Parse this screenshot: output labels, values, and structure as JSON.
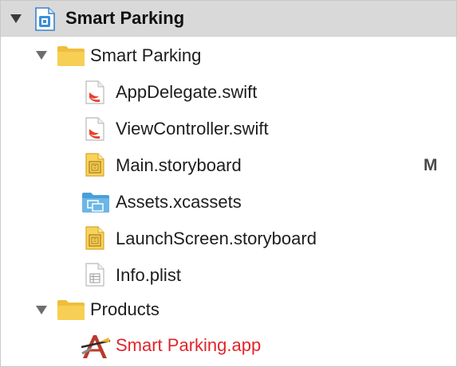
{
  "navigator": {
    "project": {
      "label": "Smart Parking",
      "icon": "xcode-project-icon"
    },
    "group": {
      "label": "Smart Parking",
      "icon": "folder-icon"
    },
    "files": [
      {
        "label": "AppDelegate.swift",
        "icon": "swift-file-icon"
      },
      {
        "label": "ViewController.swift",
        "icon": "swift-file-icon"
      },
      {
        "label": "Main.storyboard",
        "icon": "storyboard-file-icon",
        "badge": "M"
      },
      {
        "label": "Assets.xcassets",
        "icon": "asset-catalog-icon"
      },
      {
        "label": "LaunchScreen.storyboard",
        "icon": "storyboard-file-icon"
      },
      {
        "label": "Info.plist",
        "icon": "plist-file-icon"
      }
    ],
    "products_group": {
      "label": "Products",
      "icon": "folder-icon"
    },
    "product": {
      "label": "Smart Parking.app",
      "icon": "app-product-icon"
    }
  },
  "colors": {
    "selection": "#d9d9d9",
    "folder": "#f3c649",
    "swift": "#e8402f",
    "storyboard": "#f3c23a",
    "assets": "#4aa3dc",
    "missing_product": "#e0262a"
  }
}
